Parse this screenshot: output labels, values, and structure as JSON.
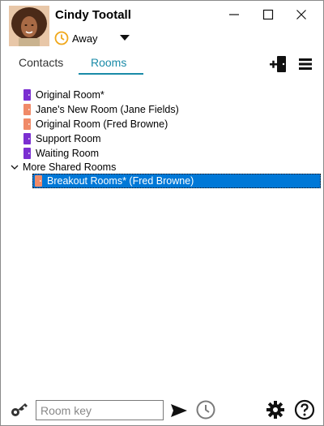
{
  "user": {
    "name": "Cindy Tootall",
    "status": "Away"
  },
  "tabs": [
    {
      "label": "Contacts",
      "active": false
    },
    {
      "label": "Rooms",
      "active": true
    }
  ],
  "rooms": [
    {
      "label": "Original Room*",
      "color": "#7b2fd1"
    },
    {
      "label": "Jane's New Room (Jane Fields)",
      "color": "#f08a68"
    },
    {
      "label": "Original Room (Fred Browne)",
      "color": "#f08a68"
    },
    {
      "label": "Support Room",
      "color": "#7b2fd1"
    },
    {
      "label": "Waiting Room",
      "color": "#7b2fd1"
    }
  ],
  "shared_group": {
    "label": "More Shared Rooms",
    "expanded": true,
    "rooms": [
      {
        "label": "Breakout Rooms* (Fred Browne)",
        "color": "#f08a68",
        "selected": true
      }
    ]
  },
  "bottom": {
    "room_key_placeholder": "Room key",
    "room_key_value": ""
  },
  "colors": {
    "accent": "#1a8ba8",
    "selection": "#0078d7",
    "away": "#f0a81c"
  }
}
